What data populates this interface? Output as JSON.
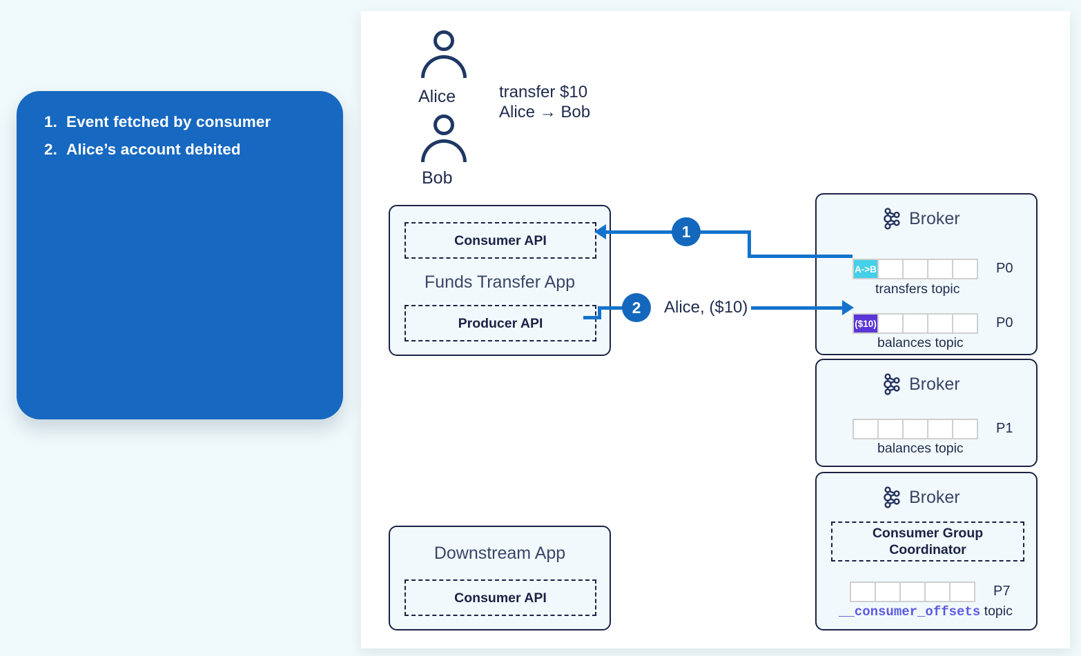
{
  "theme": {
    "page_background": "#f0f9fb",
    "panel_background": "#ffffff",
    "callout_blue": "#1668c0",
    "accent_blue": "#1373cc",
    "navy": "#1b2244",
    "box_fill": "#f2f9fd",
    "cyan_cell": "#45cfe8",
    "purple_cell": "#5b36d6",
    "mono_purple": "#5b5be0"
  },
  "callout": {
    "items": [
      {
        "num": "1.",
        "text": "Event fetched by consumer"
      },
      {
        "num": "2.",
        "text": "Alice’s account debited"
      }
    ]
  },
  "actors": {
    "alice": {
      "name": "Alice",
      "icon": "person-icon"
    },
    "bob": {
      "name": "Bob",
      "icon": "person-icon"
    },
    "transfer_note_line1": "transfer $10",
    "transfer_note_line2": "Alice → Bob"
  },
  "funds_transfer_app": {
    "title": "Funds Transfer App",
    "consumer_api": "Consumer API",
    "producer_api": "Producer API"
  },
  "downstream_app": {
    "title": "Downstream App",
    "consumer_api": "Consumer API"
  },
  "brokers": [
    {
      "label": "Broker",
      "icon": "kafka-icon",
      "partitions": [
        {
          "topic": "transfers topic",
          "partition_label": "P0",
          "cells": [
            {
              "text": "A->B",
              "fill": "cyan"
            },
            {
              "text": "",
              "fill": "none"
            },
            {
              "text": "",
              "fill": "none"
            },
            {
              "text": "",
              "fill": "none"
            },
            {
              "text": "",
              "fill": "none"
            }
          ]
        },
        {
          "topic": "balances topic",
          "partition_label": "P0",
          "cells": [
            {
              "text": "($10)",
              "fill": "purple"
            },
            {
              "text": "",
              "fill": "none"
            },
            {
              "text": "",
              "fill": "none"
            },
            {
              "text": "",
              "fill": "none"
            },
            {
              "text": "",
              "fill": "none"
            }
          ]
        }
      ]
    },
    {
      "label": "Broker",
      "icon": "kafka-icon",
      "partitions": [
        {
          "topic": "balances topic",
          "partition_label": "P1",
          "cells": [
            {
              "text": "",
              "fill": "none"
            },
            {
              "text": "",
              "fill": "none"
            },
            {
              "text": "",
              "fill": "none"
            },
            {
              "text": "",
              "fill": "none"
            },
            {
              "text": "",
              "fill": "none"
            }
          ]
        }
      ]
    },
    {
      "label": "Broker",
      "icon": "kafka-icon",
      "coordinator": "Consumer Group\nCoordinator",
      "coordinator_line1": "Consumer Group",
      "coordinator_line2": "Coordinator",
      "partitions": [
        {
          "topic_mono": "__consumer_offsets",
          "topic_suffix": " topic",
          "partition_label": "P7",
          "cells": [
            {
              "text": "",
              "fill": "none"
            },
            {
              "text": "",
              "fill": "none"
            },
            {
              "text": "",
              "fill": "none"
            },
            {
              "text": "",
              "fill": "none"
            },
            {
              "text": "",
              "fill": "none"
            }
          ]
        }
      ]
    }
  ],
  "steps": [
    {
      "number": "1",
      "label": ""
    },
    {
      "number": "2",
      "label": "Alice, ($10)"
    }
  ]
}
